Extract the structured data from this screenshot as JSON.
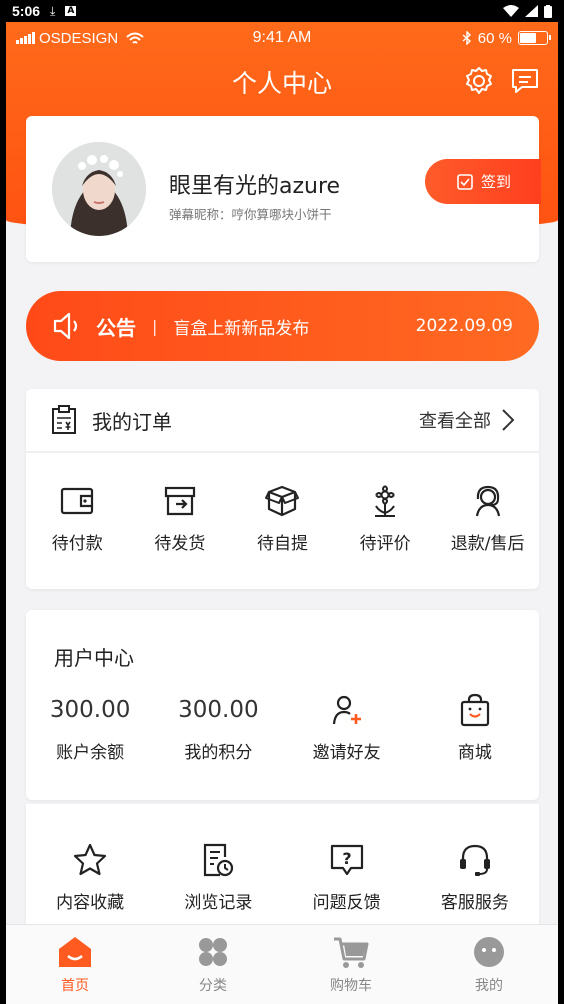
{
  "system": {
    "time": "5:06",
    "download_icon": "download-icon",
    "a_icon": "font-icon"
  },
  "ios": {
    "carrier": "OSDESIGN",
    "time": "9:41 AM",
    "battery": "60 %",
    "battery_level": 0.6
  },
  "header": {
    "title": "个人中心",
    "settings_icon": "gear-icon",
    "message_icon": "message-icon"
  },
  "profile": {
    "nickname": "眼里有光的azure",
    "subtitle": "弹幕昵称：哼你算哪块小饼干",
    "sign_label": "签到"
  },
  "notice": {
    "label": "公告",
    "separator": "|",
    "text": "盲盒上新新品发布",
    "date": "2022.09.09"
  },
  "orders": {
    "title": "我的订单",
    "view_all": "查看全部",
    "items": [
      {
        "label": "待付款",
        "icon": "wallet-icon"
      },
      {
        "label": "待发货",
        "icon": "box-out-icon"
      },
      {
        "label": "待自提",
        "icon": "package-icon"
      },
      {
        "label": "待评价",
        "icon": "flower-icon"
      },
      {
        "label": "退款/售后",
        "icon": "service-agent-icon"
      }
    ]
  },
  "user_center": {
    "title": "用户中心",
    "items": [
      {
        "value": "300.00",
        "label": "账户余额"
      },
      {
        "value": "300.00",
        "label": "我的积分"
      },
      {
        "label": "邀请好友",
        "icon": "add-user-icon"
      },
      {
        "label": "商城",
        "icon": "shopping-bag-icon"
      }
    ]
  },
  "services": [
    {
      "label": "内容收藏",
      "icon": "star-icon"
    },
    {
      "label": "浏览记录",
      "icon": "history-icon"
    },
    {
      "label": "问题反馈",
      "icon": "question-icon"
    },
    {
      "label": "客服服务",
      "icon": "headset-icon"
    }
  ],
  "tabbar": [
    {
      "label": "首页",
      "icon": "home-icon"
    },
    {
      "label": "分类",
      "icon": "category-icon"
    },
    {
      "label": "购物车",
      "icon": "cart-icon"
    },
    {
      "label": "我的",
      "icon": "profile-icon"
    }
  ],
  "colors": {
    "accent": "#ff5a1f",
    "header": "#ff6a1a"
  }
}
